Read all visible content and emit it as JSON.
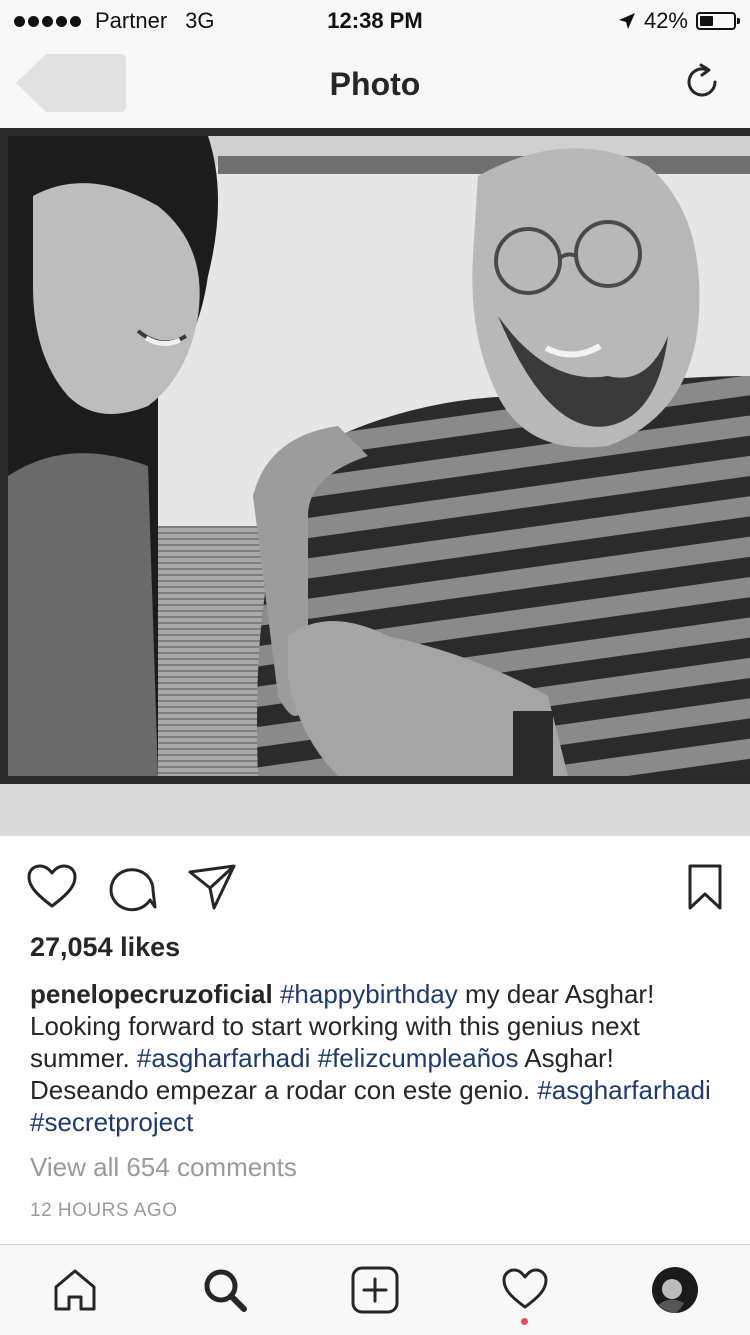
{
  "status_bar": {
    "carrier": "Partner",
    "network": "3G",
    "time": "12:38 PM",
    "battery": "42%",
    "battery_level": 0.42
  },
  "navbar": {
    "title": "Photo",
    "back_icon": "back-arrow-icon",
    "refresh_icon": "refresh-icon"
  },
  "post": {
    "likes": "27,054 likes",
    "caption": {
      "username": "penelopecruzoficial",
      "segments": [
        {
          "type": "tag",
          "text": "#happybirthday"
        },
        {
          "type": "text",
          "text": " my dear Asghar! Looking forward to start working with this genius next summer. "
        },
        {
          "type": "tag",
          "text": "#asgharfarhadi"
        },
        {
          "type": "text",
          "text": " "
        },
        {
          "type": "tag",
          "text": "#felizcumpleaños"
        },
        {
          "type": "text",
          "text": " Asghar!  Deseando  empezar a rodar con este genio. "
        },
        {
          "type": "tag",
          "text": "#asgharfarhadi"
        },
        {
          "type": "text",
          "text": " "
        },
        {
          "type": "tag",
          "text": "#secretproject"
        }
      ]
    },
    "view_comments": "View all 654 comments",
    "time_ago": "12 HOURS AGO"
  },
  "tabs": [
    "home-icon",
    "search-icon",
    "add-post-icon",
    "activity-heart-icon",
    "profile-avatar"
  ],
  "colors": {
    "hashtag": "#1f3a6e",
    "notification_dot": "#ed4956",
    "muted": "#9a9a9a"
  }
}
